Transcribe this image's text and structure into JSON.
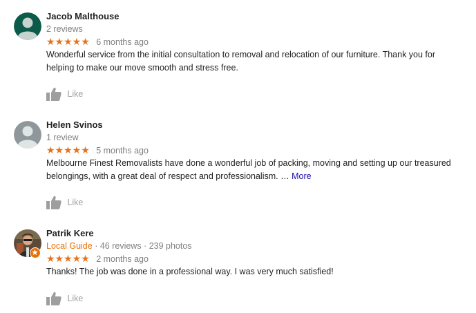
{
  "colors": {
    "star": "#e7711b",
    "local_guide": "#e8710a",
    "more_link": "#1a0dab",
    "muted_text": "#808080",
    "body_text": "#222222"
  },
  "reviews": [
    {
      "name": "Jacob Malthouse",
      "meta": "2 reviews",
      "avatar_color": "#0b5a4a",
      "avatar_icon": "person-silhouette-icon",
      "rating": 5,
      "stars": "★★★★★",
      "date": "6 months ago",
      "text": "Wonderful service from the initial consultation to removal and relocation of our furniture.  Thank you for helping to make our move smooth and stress free.",
      "like_icon": "thumbs-up-icon",
      "like_label": "Like"
    },
    {
      "name": "Helen Svinos",
      "meta": "1 review",
      "avatar_color": "#8f979b",
      "avatar_icon": "person-silhouette-icon",
      "rating": 5,
      "stars": "★★★★★",
      "date": "5 months ago",
      "text": "Melbourne Finest Removalists have done a wonderful job of packing, moving and setting up our treasured belongings, with a great deal of respect and professionalism. …",
      "more_label": "More",
      "like_icon": "thumbs-up-icon",
      "like_label": "Like"
    },
    {
      "name": "Patrik Kere",
      "local_guide": "Local Guide",
      "meta": "· 46 reviews · 239 photos",
      "avatar_icon": "profile-photo",
      "badge_icon": "local-guide-star-badge-icon",
      "rating": 5,
      "stars": "★★★★★",
      "date": "2 months ago",
      "text": "Thanks! The job was done in a professional way. I was very much satisfied!",
      "like_icon": "thumbs-up-icon",
      "like_label": "Like"
    }
  ]
}
